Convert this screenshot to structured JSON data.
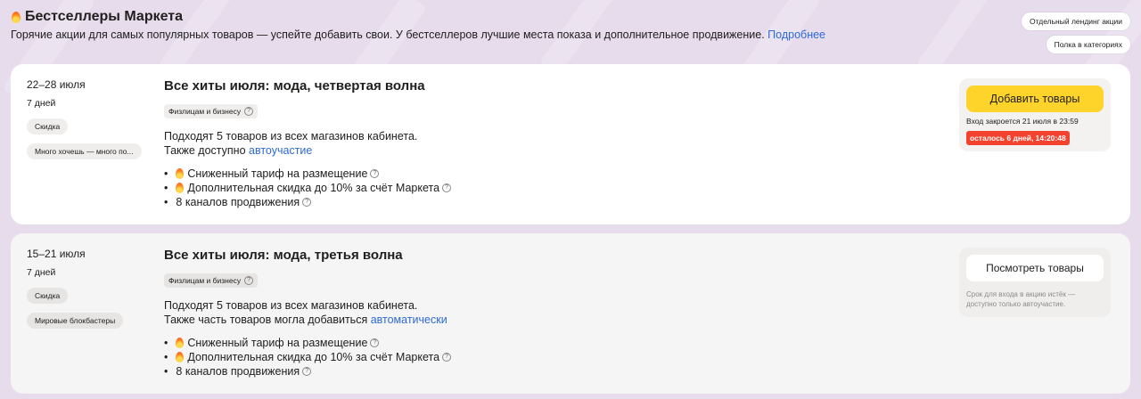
{
  "header": {
    "title": "Бестселлеры Маркета",
    "subtitle": "Горячие акции для самых популярных товаров — успейте добавить свои. У бестселлеров лучшие места показа и дополнительное продвижение.",
    "more_link": "Подробнее"
  },
  "side_buttons": {
    "landing": "Отдельный лендинг акции",
    "shelf": "Полка в категориях"
  },
  "promos": [
    {
      "dates": "22–28 июля",
      "duration": "7 дней",
      "tags": [
        "Скидка",
        "Много хочешь — много по..."
      ],
      "title": "Все хиты июля: мода, четвертая волна",
      "audience": "Физлицам и бизнесу",
      "desc_line1": "Подходят 5 товаров из всех магазинов кабинета.",
      "desc_line2_prefix": "Также доступно",
      "desc_line2_link": "автоучастие",
      "benefits": [
        "Сниженный тариф на размещение",
        "Дополнительная скидка до 10% за счёт Маркета",
        "8 каналов продвижения"
      ],
      "action_label": "Добавить товары",
      "entry_note": "Вход закроется 21 июля в 23:59",
      "timer": "осталось 6 дней, 14:20:48"
    },
    {
      "dates": "15–21 июля",
      "duration": "7 дней",
      "tags": [
        "Скидка",
        "Мировые блокбастеры"
      ],
      "title": "Все хиты июля: мода, третья волна",
      "audience": "Физлицам и бизнесу",
      "desc_line1": "Подходят 5 товаров из всех магазинов кабинета.",
      "desc_line2_prefix": "Также часть товаров могла добавиться",
      "desc_line2_link": "автоматически",
      "benefits": [
        "Сниженный тариф на размещение",
        "Дополнительная скидка до 10% за счёт Маркета",
        "8 каналов продвижения"
      ],
      "action_label": "Посмотреть товары",
      "entry_note": "Срок для входа в акцию истёк — доступно только автоучастие."
    }
  ]
}
